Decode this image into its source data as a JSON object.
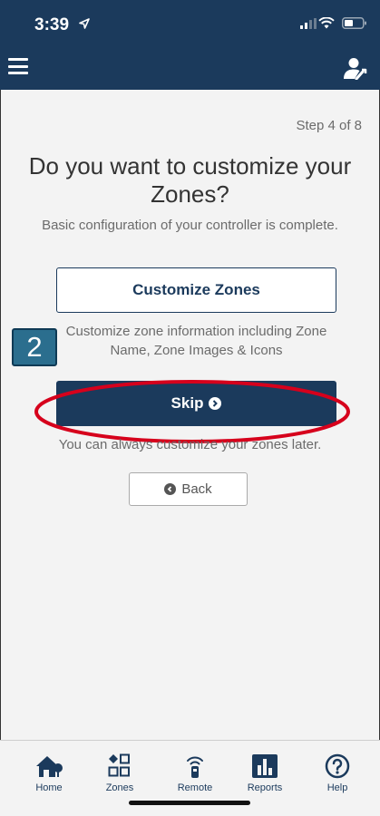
{
  "status_bar": {
    "time": "3:39"
  },
  "wizard": {
    "step": "Step 4 of 8",
    "title": "Do you want to customize your Zones?",
    "subtitle": "Basic configuration of your controller is complete.",
    "customize_label": "Customize Zones",
    "customize_description": "Customize zone information including Zone Name, Zone Images & Icons",
    "skip_label": "Skip",
    "skip_note": "You can always customize your zones later.",
    "back_label": "Back"
  },
  "annotation": {
    "badge": "2",
    "highlight_color": "#d6001c"
  },
  "tabs": [
    {
      "label": "Home",
      "icon": "home-icon"
    },
    {
      "label": "Zones",
      "icon": "zones-icon"
    },
    {
      "label": "Remote",
      "icon": "remote-icon"
    },
    {
      "label": "Reports",
      "icon": "reports-icon"
    },
    {
      "label": "Help",
      "icon": "help-icon"
    }
  ],
  "colors": {
    "primary": "#1b3a5c",
    "background": "#f3f3f3",
    "text_muted": "#6b6b6b"
  }
}
